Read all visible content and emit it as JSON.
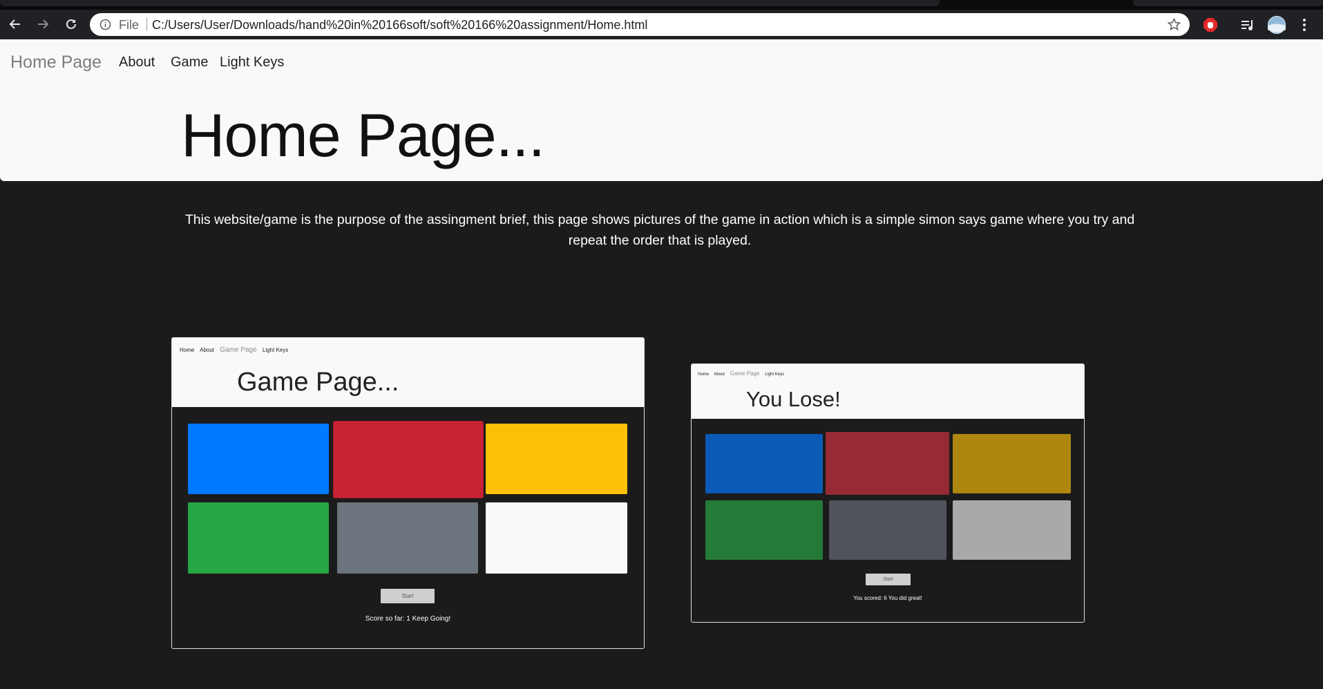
{
  "browser": {
    "scheme": "File",
    "url": "C:/Users/User/Downloads/hand%20in%20166soft/soft%20166%20assignment/Home.html",
    "icons": [
      "back-arrow-icon",
      "forward-arrow-icon",
      "reload-icon",
      "info-icon",
      "star-icon",
      "adblock-icon",
      "media-playlist-icon",
      "profile-avatar-icon",
      "menu-dots-icon"
    ]
  },
  "nav": {
    "brand": "Home Page",
    "links": [
      "About",
      "Game",
      "Light Keys"
    ]
  },
  "hero": {
    "title": "Home Page..."
  },
  "intro": "This website/game is the purpose of the assingment brief, this page shows pictures of the game in action which is a simple simon says game where you try and repeat the order that is played.",
  "screenshots": [
    {
      "nav": [
        "Home",
        "About",
        "Game Page",
        "Light Keys"
      ],
      "active_nav": "Game Page",
      "title": "Game Page...",
      "tiles": [
        "#007bff",
        "#c82333",
        "#ffc107",
        "#28a745",
        "#6c757d",
        "#f8f9fa"
      ],
      "start_label": "Start",
      "status": "Score so far: 1 Keep Going!"
    },
    {
      "nav": [
        "Home",
        "About",
        "Game Page",
        "Light Keys"
      ],
      "active_nav": "Game Page",
      "title": "You Lose!",
      "tiles": [
        "#0b5bb6",
        "#962a35",
        "#b0870e",
        "#247a37",
        "#50545a",
        "#a9a9a9"
      ],
      "start_label": "Start",
      "status": "You scored: 6 You did great!"
    }
  ]
}
